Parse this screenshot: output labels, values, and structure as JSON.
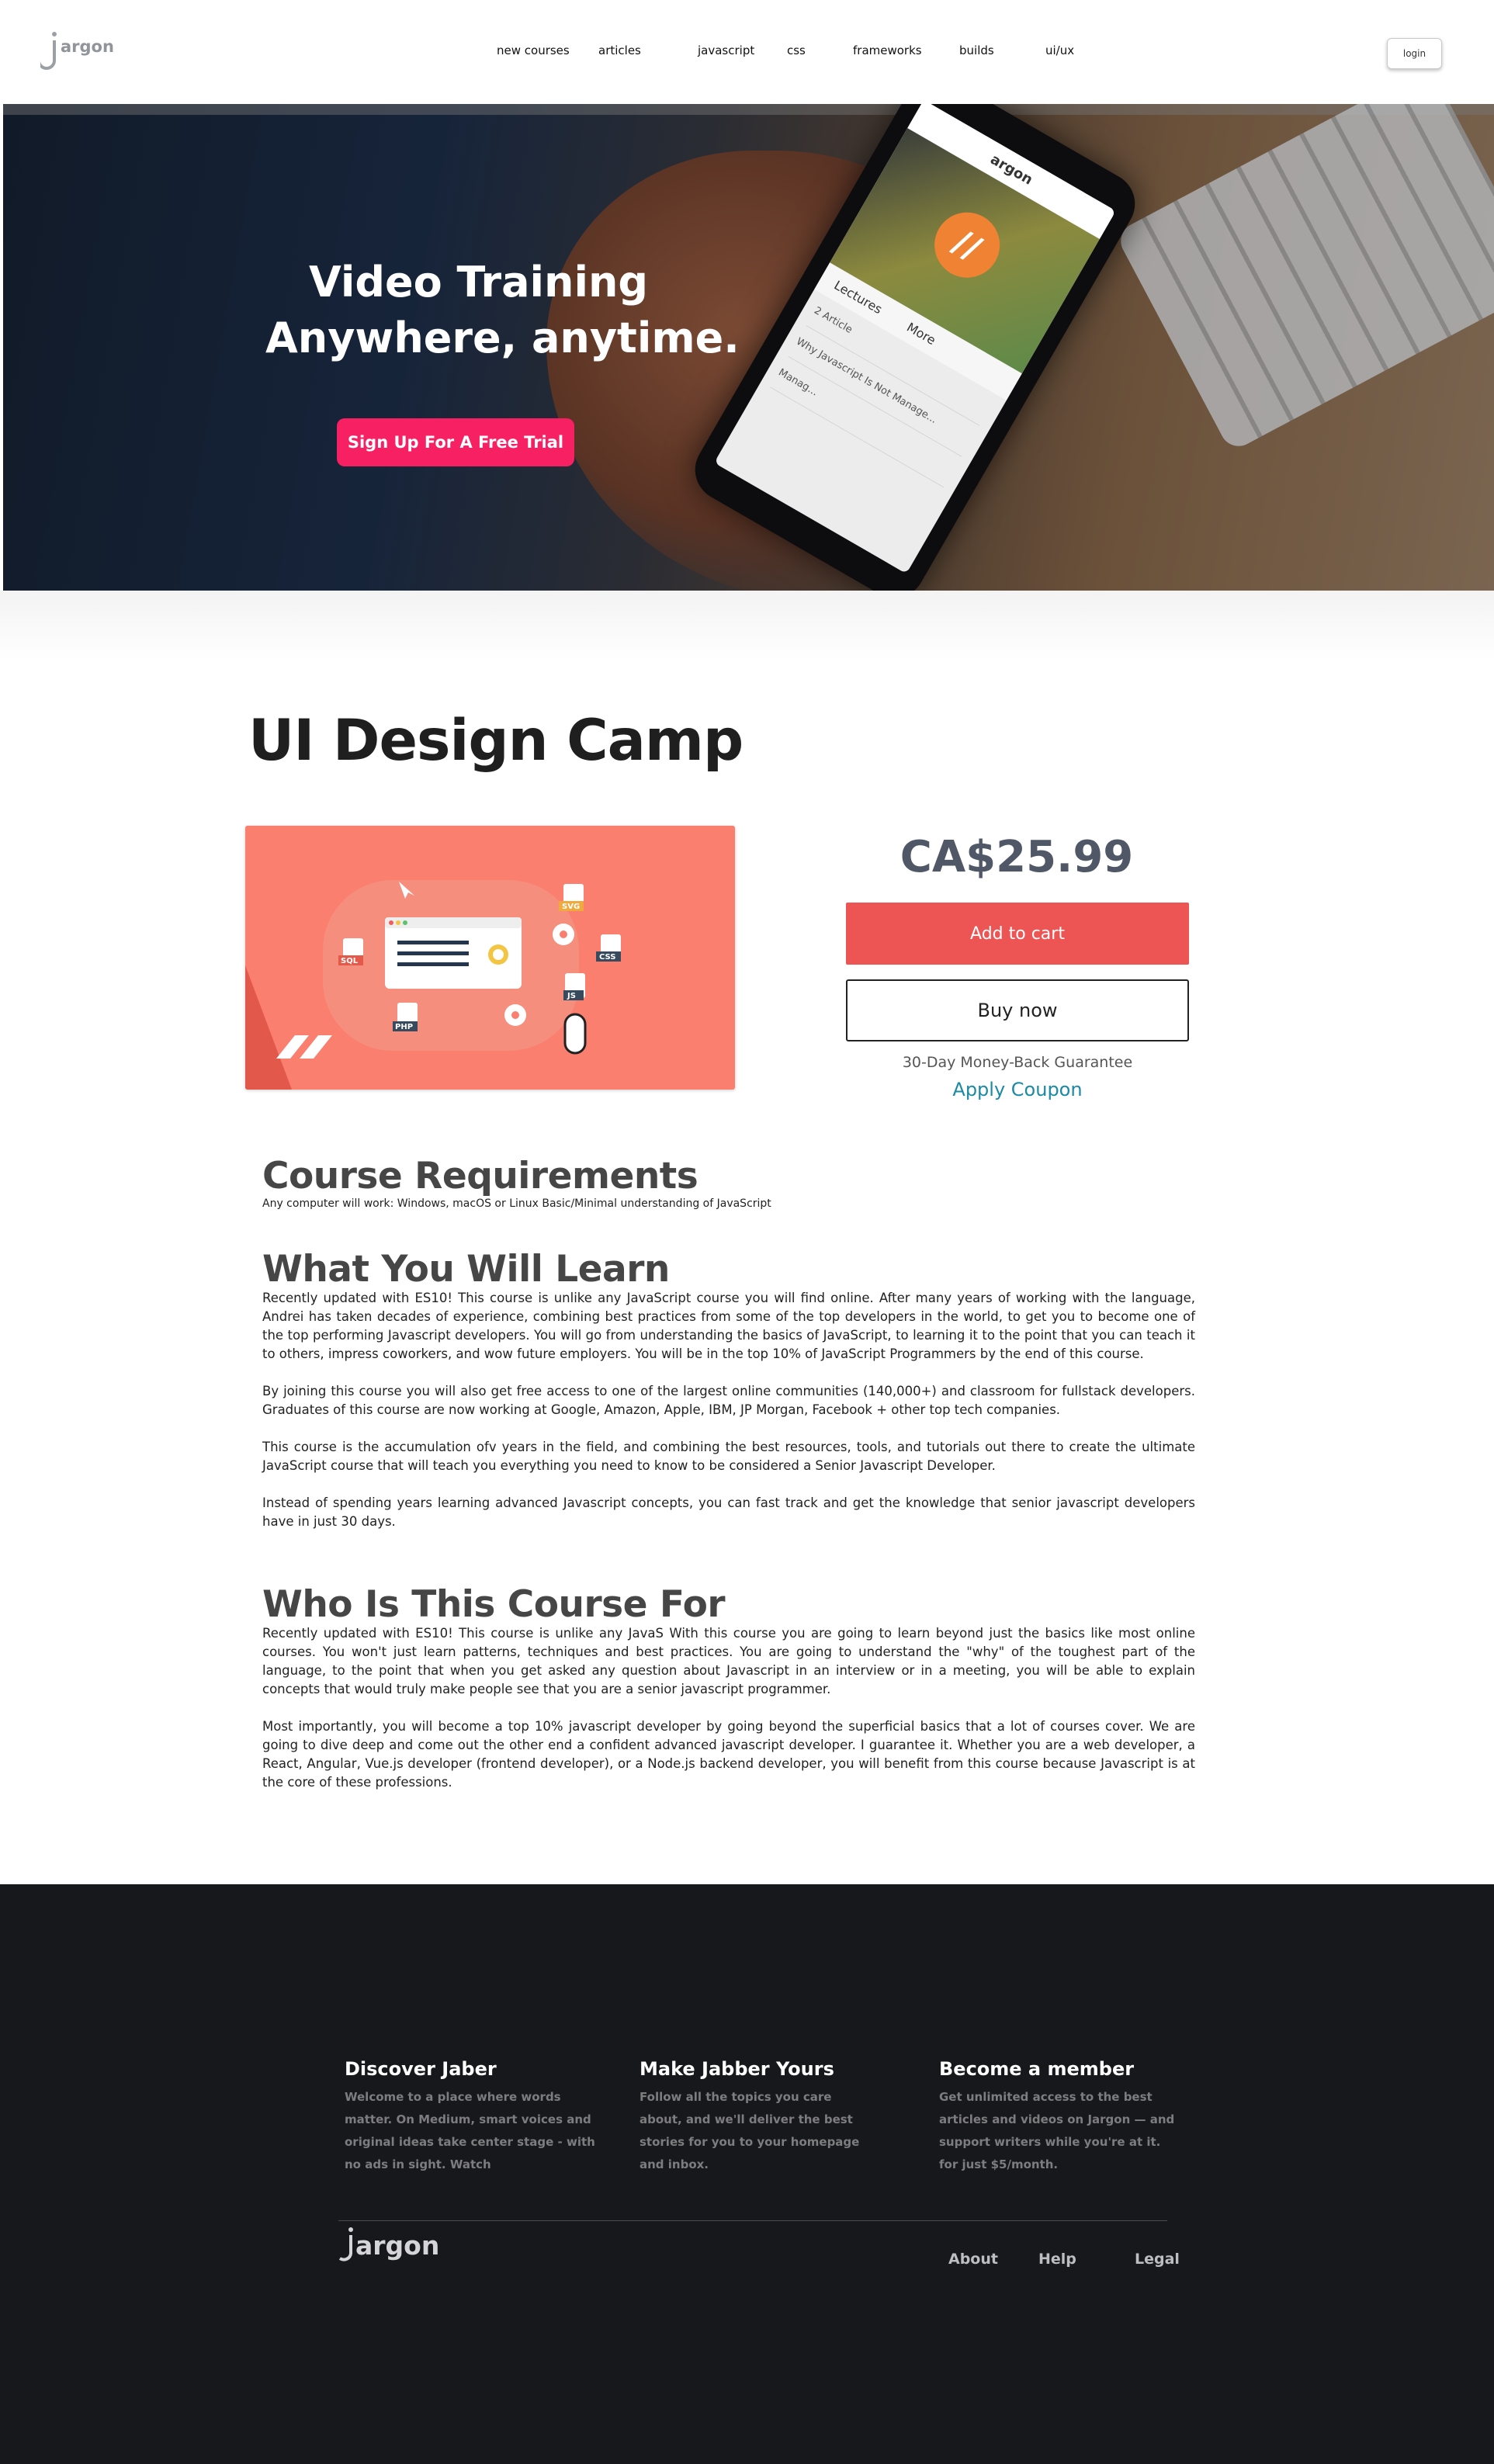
{
  "nav": {
    "logo_text": "argon",
    "items": [
      "new courses",
      "articles",
      "javascript",
      "css",
      "frameworks",
      "builds",
      "ui/ux"
    ],
    "login_label": "login"
  },
  "hero": {
    "title_line1": "Video Training",
    "title_line2": "Anywhere, anytime.",
    "cta_label": "Sign Up For A Free Trial",
    "phone_brand": "argon",
    "phone_tabs": [
      "Lectures",
      "More"
    ],
    "phone_rows": [
      "2  Article",
      "Why Javascript Is Not Manage...",
      "Manag..."
    ]
  },
  "product": {
    "title": "UI Design Camp",
    "price": "CA$25.99",
    "add_to_cart": "Add to cart",
    "buy_now": "Buy now",
    "guarantee": "30-Day Money-Back Guarantee",
    "coupon": "Apply Coupon",
    "image_tags": [
      "SQL",
      "SVG",
      "CSS",
      "JS",
      "PHP"
    ]
  },
  "requirements": {
    "heading": "Course Requirements",
    "text": "Any computer will work: Windows, macOS or Linux  Basic/Minimal understanding of JavaScript"
  },
  "learn": {
    "heading": "What You Will Learn",
    "paragraphs": [
      "Recently updated with ES10! This course is unlike any JavaScript course you will find online. After many years of working with the language, Andrei has taken decades of experience, combining best practices from some of the top developers in the world, to get you to become one of the top performing Javascript developers. You will go from understanding the basics of JavaScript, to learning it to the point that you can teach it to others, impress coworkers, and wow future employers. You will be in the top 10% of JavaScript Programmers by the end of this course.",
      "By joining this course you will also get free access to one of the largest online communities (140,000+) and classroom for fullstack developers. Graduates of this course are now working at Google, Amazon, Apple, IBM, JP Morgan, Facebook + other top tech companies.",
      "This course is the accumulation ofv years in the field, and combining the best resources, tools, and tutorials out there to create the ultimate JavaScript course that will teach you everything you need to know to be considered a Senior Javascript Developer.",
      "Instead of spending years learning advanced Javascript concepts, you can fast track and get the knowledge that senior javascript developers have in just 30 days."
    ]
  },
  "who": {
    "heading": "Who Is This Course For",
    "paragraphs": [
      "Recently updated with ES10! This course is unlike any JavaS  With this course you are going to learn beyond just the basics like most online courses. You won't just learn patterns, techniques and best practices. You are going to understand the \"why\" of the toughest part of the language, to the point that when you get asked any question about Javascript in an interview or in a meeting, you will be able to explain concepts that would truly make people see that you are a senior javascript programmer.",
      "Most importantly, you will become a top 10% javascript developer by going beyond the superficial basics that a lot of courses cover. We are going to dive deep and come out the other end a confident advanced javascript developer. I guarantee it. Whether you are a web developer, a React, Angular, Vue.js developer (frontend developer), or a Node.js backend developer, you will benefit from this course because Javascript is at the core of these professions."
    ]
  },
  "footer": {
    "columns": [
      {
        "title": "Discover Jaber",
        "lines": [
          "Welcome to a place where words",
          "matter. On Medium, smart voices and",
          "original ideas take center stage - with",
          "no ads in sight. Watch"
        ]
      },
      {
        "title": "Make Jabber Yours",
        "lines": [
          "Follow all the topics you care",
          "about, and we'll deliver the best",
          "stories for you to your homepage",
          "and inbox."
        ]
      },
      {
        "title": "Become a member",
        "lines": [
          "Get unlimited access to the best",
          "articles and videos on Jargon — and",
          "support writers while you're at it.",
          "for just $5/month."
        ]
      }
    ],
    "logo_text": "argon",
    "links": [
      "About",
      "Help",
      "Legal"
    ]
  },
  "colors": {
    "accent_pink": "#f72063",
    "cart_red": "#ed5454",
    "coupon_teal": "#1a8aa5",
    "footer_bg": "#17181b"
  }
}
